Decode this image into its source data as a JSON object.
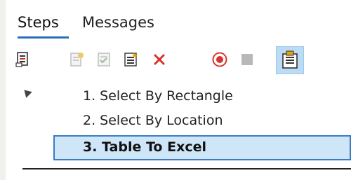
{
  "tabs": {
    "steps": "Steps",
    "messages": "Messages"
  },
  "toolbar": {
    "icons": [
      "model-icon",
      "add-step-icon",
      "edit-step-icon",
      "new-step-icon",
      "delete-icon",
      "record-icon",
      "stop-icon",
      "table-icon"
    ],
    "colors": {
      "delete": "#d9342b",
      "record": "#d9342b",
      "stop": "#b8b8b8",
      "active_bg": "#bcdcf5"
    }
  },
  "steps": [
    {
      "label": "1.  Select By Rectangle"
    },
    {
      "label": "2.  Select By Location"
    },
    {
      "label": "3.  Table To Excel"
    }
  ],
  "selected_step": 3,
  "accent": "#2a6fb5"
}
